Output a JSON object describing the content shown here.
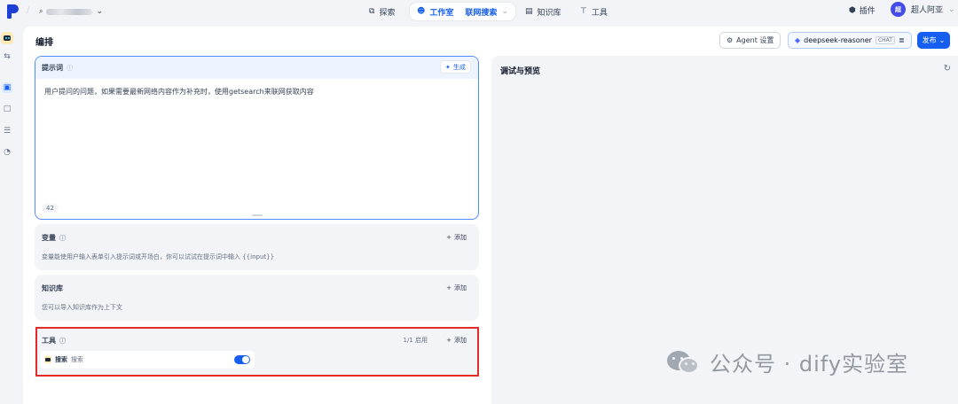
{
  "topbar": {
    "workspace_chevron": "⌄",
    "nav": [
      {
        "label": "探索",
        "icon": "compass-icon"
      },
      {
        "label": "工作室",
        "icon": "robot-icon"
      },
      {
        "label": "知识库",
        "icon": "book-icon"
      },
      {
        "label": "工具",
        "icon": "tool-icon"
      }
    ],
    "current_app": "联网搜索",
    "plugins_label": "插件",
    "user_avatar_text": "超",
    "user_name": "超人阿亚"
  },
  "editor": {
    "title": "编排",
    "agent_settings_label": "Agent 设置",
    "model_name": "deepseek-reasoner",
    "model_mode": "CHAT",
    "publish_label": "发布"
  },
  "prompt": {
    "title": "提示词",
    "generate_label": "生成",
    "text": "用户提问的问题，如果需要最新网络内容作为补充时，使用getsearch来联网获取内容",
    "char_count": "42"
  },
  "variables": {
    "title": "变量",
    "add_label": "添加",
    "description": "变量能使用户输入表单引入提示词或开场白，你可以试试在提示词中输入 {{input}}"
  },
  "knowledge": {
    "title": "知识库",
    "add_label": "添加",
    "description": "您可以导入知识库作为上下文"
  },
  "tools": {
    "title": "工具",
    "enabled_count": "1/1 启用",
    "add_label": "添加",
    "items": [
      {
        "name": "搜索",
        "label": "搜索",
        "enabled": true
      }
    ]
  },
  "preview": {
    "title": "调试与预览"
  },
  "watermark": {
    "text": "公众号 · dify实验室"
  },
  "colors": {
    "accent": "#155eef",
    "highlight_border": "#e52a2a"
  }
}
